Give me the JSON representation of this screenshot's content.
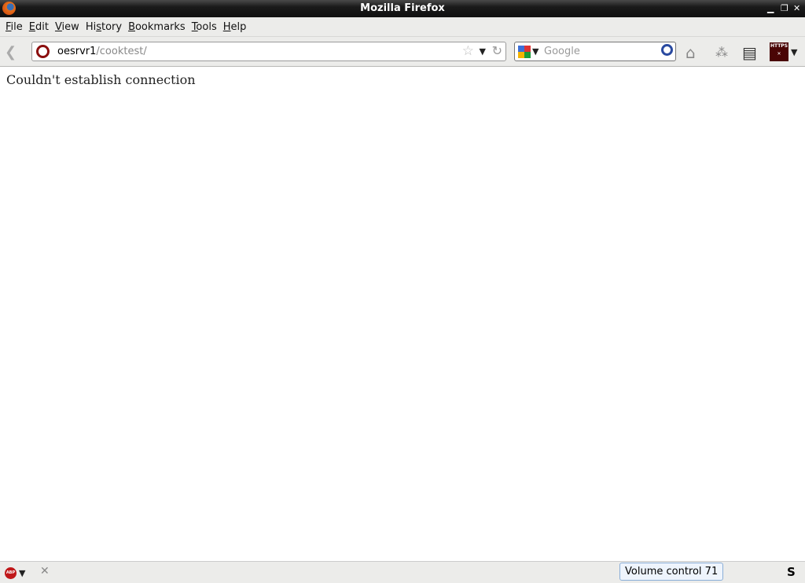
{
  "window": {
    "title": "Mozilla Firefox",
    "controls": [
      "minimize",
      "restore",
      "close"
    ]
  },
  "menu": [
    {
      "label": "File",
      "key": "F",
      "rest": "ile"
    },
    {
      "label": "Edit",
      "key": "E",
      "rest": "dit"
    },
    {
      "label": "View",
      "key": "V",
      "rest": "iew"
    },
    {
      "label": "History",
      "pre": "Hi",
      "key": "s",
      "rest": "tory"
    },
    {
      "label": "Bookmarks",
      "key": "B",
      "rest": "ookmarks"
    },
    {
      "label": "Tools",
      "key": "T",
      "rest": "ools"
    },
    {
      "label": "Help",
      "key": "H",
      "rest": "elp"
    }
  ],
  "urlbar": {
    "host": "oesrvr1",
    "path": "/cooktest/"
  },
  "search": {
    "placeholder": "Google"
  },
  "https_badge": "HTTPS",
  "abp_badge": "ABP",
  "content": {
    "message": "Couldn't establish connection"
  },
  "statusbar": {
    "volume": "Volume control 71"
  }
}
